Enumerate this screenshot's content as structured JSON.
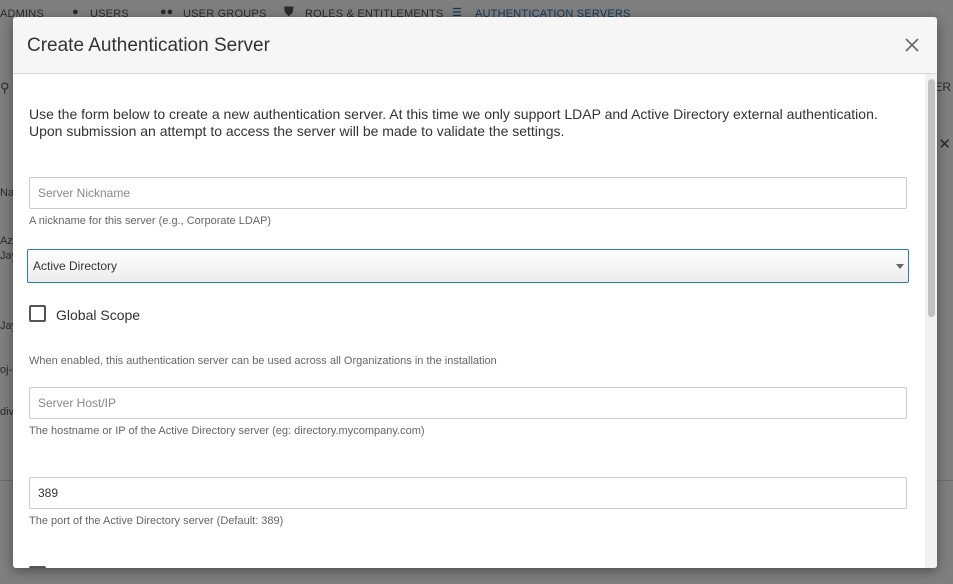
{
  "background": {
    "tabs": [
      {
        "label": "ADMINS"
      },
      {
        "label": "USERS"
      },
      {
        "label": "USER GROUPS"
      },
      {
        "label": "ROLES & ENTITLEMENTS"
      },
      {
        "label": "AUTHENTICATION SERVERS"
      }
    ],
    "side_items": [
      "Nar",
      "Azu",
      "Jay",
      "Jay",
      "oj-",
      "div"
    ],
    "right_text": "YER",
    "accent_color": "#2a6fb5"
  },
  "modal": {
    "title": "Create Authentication Server",
    "intro_line1": "Use the form below to create a new authentication server. At this time we only support LDAP and Active Directory external authentication.",
    "intro_line2": "Upon submission an attempt to access the server will be made to validate the settings.",
    "nickname": {
      "placeholder": "Server Nickname",
      "value": "",
      "help": "A nickname for this server (e.g., Corporate LDAP)"
    },
    "server_type": {
      "selected": "Active Directory"
    },
    "global_scope": {
      "label": "Global Scope",
      "checked": false,
      "help": "When enabled, this authentication server can be used across all Organizations in the installation"
    },
    "host": {
      "placeholder": "Server Host/IP",
      "value": "",
      "help": "The hostname or IP of the Active Directory server (eg: directory.mycompany.com)"
    },
    "port": {
      "value": "389",
      "help": "The port of the Active Directory server (Default: 389)"
    }
  }
}
